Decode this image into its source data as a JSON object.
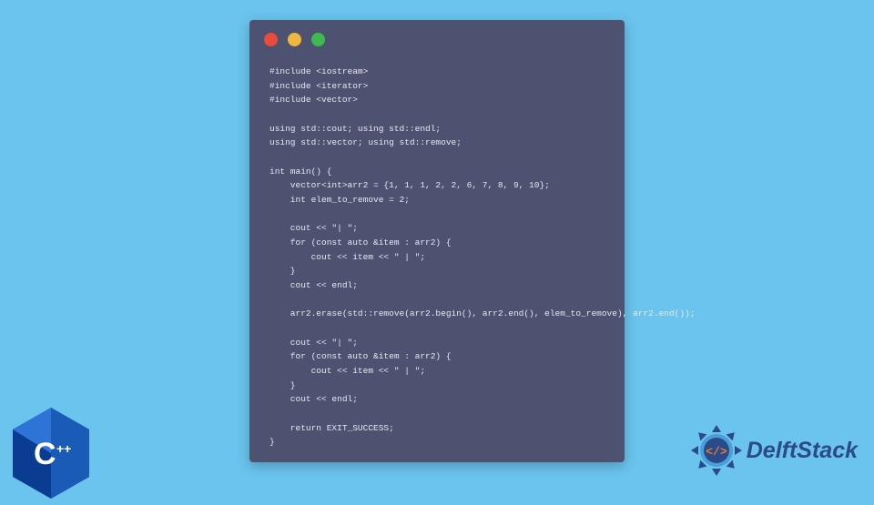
{
  "window": {
    "dots": [
      "red",
      "yellow",
      "green"
    ]
  },
  "code": {
    "lines": [
      "#include <iostream>",
      "#include <iterator>",
      "#include <vector>",
      "",
      "using std::cout; using std::endl;",
      "using std::vector; using std::remove;",
      "",
      "int main() {",
      "    vector<int>arr2 = {1, 1, 1, 2, 2, 6, 7, 8, 9, 10};",
      "    int elem_to_remove = 2;",
      "",
      "    cout << \"| \";",
      "    for (const auto &item : arr2) {",
      "        cout << item << \" | \";",
      "    }",
      "    cout << endl;",
      "",
      "    arr2.erase(std::remove(arr2.begin(), arr2.end(), elem_to_remove), arr2.end());",
      "",
      "    cout << \"| \";",
      "    for (const auto &item : arr2) {",
      "        cout << item << \" | \";",
      "    }",
      "    cout << endl;",
      "",
      "    return EXIT_SUCCESS;",
      "}"
    ]
  },
  "logos": {
    "cpp_label": "C++",
    "delft_label": "DelftStack"
  },
  "colors": {
    "background": "#6ac4ee",
    "window": "#4c5270",
    "text": "#e8e8f0",
    "cpp_blue_outer": "#0a3d91",
    "cpp_blue_inner": "#3a7bd5",
    "delft_blue": "#2a4a8a",
    "delft_orange": "#e67a2e",
    "delft_cyan": "#4a9fd8"
  }
}
